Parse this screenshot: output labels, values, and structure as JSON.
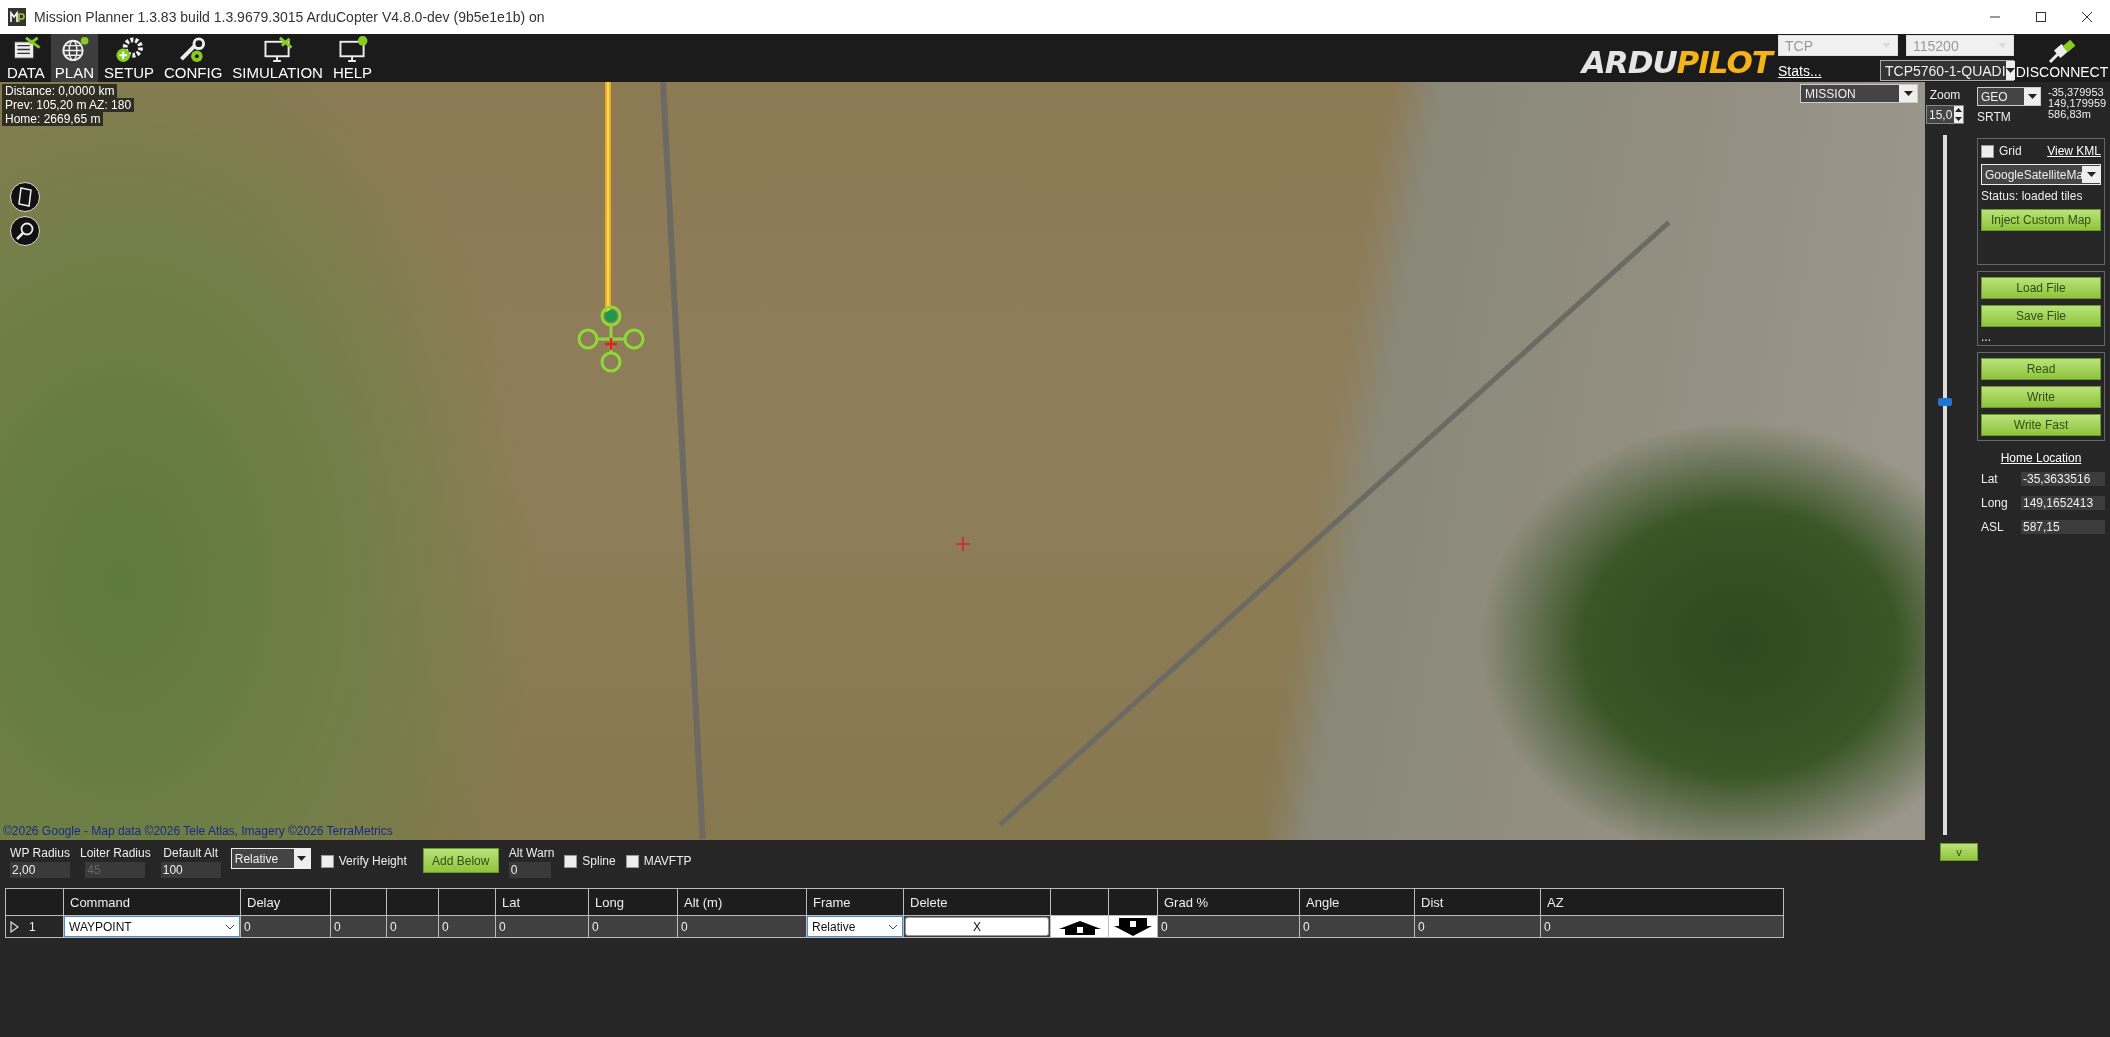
{
  "window": {
    "title": "Mission Planner 1.3.83 build 1.3.9679.3015 ArduCopter V4.8.0-dev (9b5e1e1b) on"
  },
  "toolbar": {
    "tabs": [
      {
        "label": "DATA",
        "kind": "data",
        "selected": false
      },
      {
        "label": "PLAN",
        "kind": "plan",
        "selected": true
      },
      {
        "label": "SETUP",
        "kind": "setup",
        "selected": false
      },
      {
        "label": "CONFIG",
        "kind": "config",
        "selected": false
      },
      {
        "label": "SIMULATION",
        "kind": "simulation",
        "selected": false
      },
      {
        "label": "HELP",
        "kind": "help",
        "selected": false
      }
    ]
  },
  "logo": {
    "parts": [
      "ARDU",
      "PILOT"
    ]
  },
  "connection": {
    "port": "TCP",
    "baud": "115200",
    "stats_link": "Stats...",
    "device": "TCP5760-1-QUADI",
    "connect_button": "DISCONNECT"
  },
  "map": {
    "info": [
      "Distance: 0,0000 km",
      "Prev: 105,20 m AZ: 180",
      "Home: 2669,65 m"
    ],
    "attribution": "©2026 Google - Map data ©2026 Tele Atlas, Imagery ©2026 TerraMetrics",
    "layer_select": "MISSION"
  },
  "map_controls": {
    "zoom_label": "Zoom",
    "zoom_value": "15,0",
    "zoom_slider": {
      "level": 0.62
    },
    "coord_system": "GEO",
    "cursor_coords": [
      "-35,379953",
      "149,179959",
      "586,83m"
    ],
    "elevation_source": "SRTM"
  },
  "side_panel": {
    "grid": {
      "label": "Grid",
      "checked": false
    },
    "kml_link": "View KML",
    "map_provider": "GoogleSatelliteMa",
    "status": "Status: loaded tiles",
    "inject_button": "Inject Custom Map",
    "file_buttons": [
      "Load File",
      "Save File"
    ],
    "more": "...",
    "mission_buttons": [
      "Read",
      "Write",
      "Write Fast"
    ],
    "home": {
      "title": "Home Location",
      "fields": [
        {
          "label": "Lat",
          "value": "-35,3633516"
        },
        {
          "label": "Long",
          "value": "149,1652413"
        },
        {
          "label": "ASL",
          "value": "587,15"
        }
      ]
    }
  },
  "plan_options": {
    "wp_radius": {
      "label": "WP Radius",
      "value": "2,00",
      "disabled": false
    },
    "loiter_radius": {
      "label": "Loiter Radius",
      "value": "45",
      "disabled": true
    },
    "default_alt": {
      "label": "Default Alt",
      "value": "100",
      "disabled": false
    },
    "altitude_frame": "Relative",
    "verify_height": {
      "label": "Verify Height",
      "checked": false
    },
    "add_below": "Add Below",
    "alt_warn": {
      "label": "Alt Warn",
      "value": "0"
    },
    "spline": {
      "label": "Spline",
      "checked": false
    },
    "mavftp": {
      "label": "MAVFTP",
      "checked": false
    }
  },
  "collapse_button": "v",
  "waypoint_table": {
    "columns": [
      {
        "kind": "text",
        "label": "Command"
      },
      {
        "kind": "text",
        "label": "Delay"
      },
      {
        "kind": "blank"
      },
      {
        "kind": "blank"
      },
      {
        "kind": "blank"
      },
      {
        "kind": "text",
        "label": "Lat"
      },
      {
        "kind": "text",
        "label": "Long"
      },
      {
        "kind": "text",
        "label": "Alt (m)"
      },
      {
        "kind": "text",
        "label": "Frame"
      },
      {
        "kind": "text",
        "label": "Delete"
      },
      {
        "kind": "blank"
      },
      {
        "kind": "blank"
      },
      {
        "kind": "text",
        "label": "Grad %"
      },
      {
        "kind": "text",
        "label": "Angle"
      },
      {
        "kind": "text",
        "label": "Dist"
      },
      {
        "kind": "text",
        "label": "AZ"
      }
    ],
    "rows": [
      {
        "number": "1",
        "current": true,
        "cells": [
          {
            "kind": "combo",
            "value": "WAYPOINT"
          },
          {
            "kind": "text",
            "value": "0"
          },
          {
            "kind": "text",
            "value": "0"
          },
          {
            "kind": "text",
            "value": "0"
          },
          {
            "kind": "text",
            "value": "0"
          },
          {
            "kind": "text",
            "value": "0"
          },
          {
            "kind": "text",
            "value": "0"
          },
          {
            "kind": "text",
            "value": "0"
          },
          {
            "kind": "combo",
            "value": "Relative"
          },
          {
            "kind": "button",
            "value": "X"
          },
          {
            "kind": "up"
          },
          {
            "kind": "down"
          },
          {
            "kind": "text",
            "value": "0"
          },
          {
            "kind": "text",
            "value": "0"
          },
          {
            "kind": "text",
            "value": "0"
          },
          {
            "kind": "text",
            "value": "0"
          }
        ]
      }
    ]
  }
}
